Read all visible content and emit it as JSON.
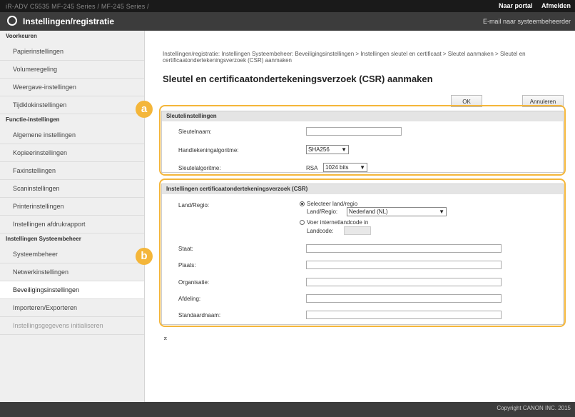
{
  "topbar": {
    "device": "iR-ADV C5535   MF-245 Series / MF-245 Series /",
    "portal_link": "Naar portal",
    "logout_link": "Afmelden"
  },
  "titlebar": {
    "title": "Instellingen/registratie",
    "mail": "E-mail naar systeembeheerder"
  },
  "sidebar": {
    "sections": [
      {
        "heading": "Voorkeuren"
      },
      {
        "heading": "Functie-instellingen"
      },
      {
        "heading": "Instellingen Systeembeheer"
      }
    ],
    "items": [
      "Papierinstellingen",
      "Volumeregeling",
      "Weergave-instellingen",
      "Tijdklokinstellingen",
      "Algemene instellingen",
      "Kopieerinstellingen",
      "Faxinstellingen",
      "Scaninstellingen",
      "Printerinstellingen",
      "Instellingen afdrukrapport",
      "Systeembeheer",
      "Netwerkinstellingen",
      "Beveiligingsinstellingen",
      "Importeren/Exporteren",
      "Instellingsgegevens initialiseren"
    ]
  },
  "main": {
    "breadcrumb": "Instellingen/registratie: Instellingen Systeembeheer: Beveiligingsinstellingen > Instellingen sleutel en certificaat > Sleutel aanmaken > Sleutel en certificaatondertekeningsverzoek (CSR) aanmaken",
    "heading": "Sleutel en certificaatondertekeningsverzoek (CSR) aanmaken",
    "ok_label": "OK",
    "cancel_label": "Annuleren",
    "key_panel": {
      "title": "Sleutelinstellingen",
      "key_name_label": "Sleutelnaam:",
      "key_name_value": "",
      "sig_alg_label": "Handtekeningalgoritme:",
      "sig_alg_value": "SHA256",
      "key_alg_label": "Sleutelalgoritme:",
      "key_alg_prefix": "RSA",
      "key_alg_value": "1024 bits"
    },
    "csr_panel": {
      "title": "Instellingen certificaatondertekeningsverzoek (CSR)",
      "country_label": "Land/Regio:",
      "select_option_label": "Selecteer land/regio",
      "country_select_label": "Land/Regio:",
      "country_value": "Nederland (NL)",
      "enter_code_label": "Voer internetlandcode in",
      "code_label": "Landcode:",
      "state_label": "Staat:",
      "city_label": "Plaats:",
      "org_label": "Organisatie:",
      "dept_label": "Afdeling:",
      "common_label": "Standaardnaam:"
    },
    "badges": {
      "a": "a",
      "b": "b"
    },
    "to_top": "⌅"
  },
  "footer": {
    "copyright": "Copyright CANON INC. 2015"
  },
  "colors": {
    "highlight": "#f4b63a",
    "titlebar": "#3c3c3c",
    "topbar": "#1a1a1a"
  }
}
